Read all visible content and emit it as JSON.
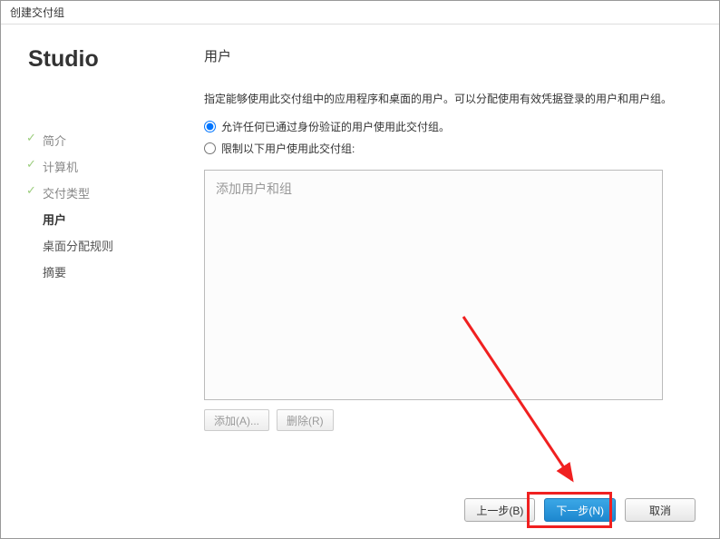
{
  "window": {
    "title": "创建交付组"
  },
  "sidebar": {
    "brand": "Studio",
    "steps": [
      {
        "label": "简介",
        "state": "done"
      },
      {
        "label": "计算机",
        "state": "done"
      },
      {
        "label": "交付类型",
        "state": "done"
      },
      {
        "label": "用户",
        "state": "active"
      },
      {
        "label": "桌面分配规则",
        "state": "future"
      },
      {
        "label": "摘要",
        "state": "future"
      }
    ]
  },
  "main": {
    "heading": "用户",
    "description": "指定能够使用此交付组中的应用程序和桌面的用户。可以分配使用有效凭据登录的用户和用户组。",
    "radio_allow_any": "允许任何已通过身份验证的用户使用此交付组。",
    "radio_restrict": "限制以下用户使用此交付组:",
    "listbox_placeholder": "添加用户和组",
    "btn_add": "添加(A)...",
    "btn_remove": "删除(R)"
  },
  "footer": {
    "back": "上一步(B)",
    "next": "下一步(N)",
    "cancel": "取消"
  },
  "annotation": {
    "highlight_color": "#f02020"
  }
}
